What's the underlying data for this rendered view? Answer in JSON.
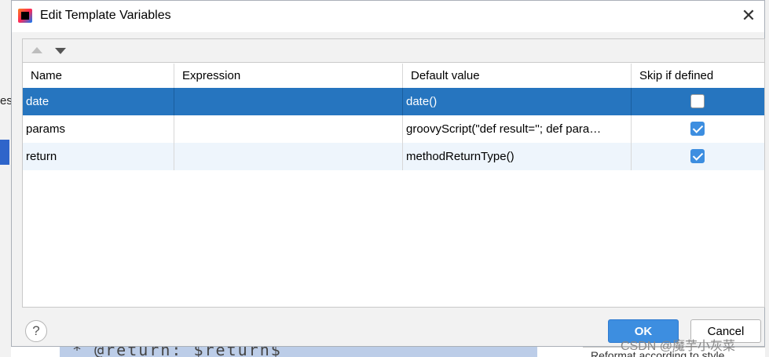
{
  "dialog": {
    "title": "Edit Template Variables",
    "close_glyph": "✕",
    "help_glyph": "?",
    "ok_label": "OK",
    "cancel_label": "Cancel"
  },
  "table": {
    "columns": [
      "Name",
      "Expression",
      "Default value",
      "Skip if defined"
    ],
    "rows": [
      {
        "name": "date",
        "expression": "",
        "default_value": "date()",
        "skip_if_defined": false,
        "selected": true
      },
      {
        "name": "params",
        "expression": "",
        "default_value": "groovyScript(\"def result=''; def para…",
        "skip_if_defined": true,
        "selected": false
      },
      {
        "name": "return",
        "expression": "",
        "default_value": "methodReturnType()",
        "skip_if_defined": true,
        "selected": false
      }
    ]
  },
  "background": {
    "left_fragment": "es",
    "code_fragment": "* @return: $return$",
    "right_fragment": "Reformat according to style"
  },
  "watermark": "CSDN @魔芋小灰菜",
  "colors": {
    "selection": "#2675bf",
    "accent": "#3d8ee0"
  }
}
